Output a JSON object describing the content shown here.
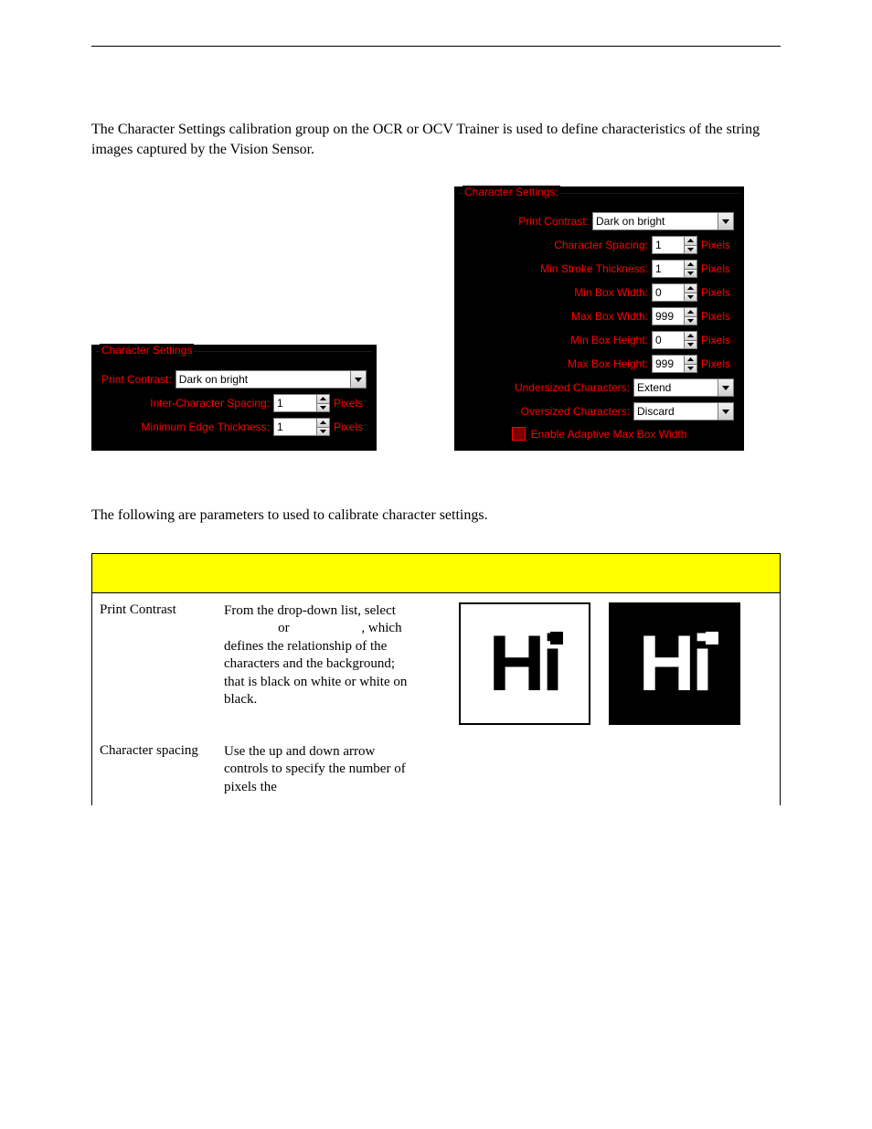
{
  "intro_text": "The Character Settings calibration group on the OCR or OCV Trainer is used to define characteristics of the string images captured by the Vision Sensor.",
  "panel_left": {
    "legend": "Character Settings",
    "rows": {
      "print_contrast": {
        "label": "Print Contrast:",
        "value": "Dark on bright"
      },
      "inter_char_spacing": {
        "label": "Inter-Character Spacing:",
        "value": "1",
        "unit": "Pixels"
      },
      "min_edge_thickness": {
        "label": "Minimum Edge Thickness:",
        "value": "1",
        "unit": "Pixels"
      }
    }
  },
  "panel_right": {
    "legend": "Character Settings:",
    "rows": {
      "print_contrast": {
        "label": "Print Contrast:",
        "value": "Dark on bright"
      },
      "char_spacing": {
        "label": "Character Spacing:",
        "value": "1",
        "unit": "Pixels"
      },
      "min_stroke": {
        "label": "Min Stroke Thickness:",
        "value": "1",
        "unit": "Pixels"
      },
      "min_box_width": {
        "label": "Min Box Width:",
        "value": "0",
        "unit": "Pixels"
      },
      "max_box_width": {
        "label": "Max Box Width:",
        "value": "999",
        "unit": "Pixels"
      },
      "min_box_height": {
        "label": "Min Box Height:",
        "value": "0",
        "unit": "Pixels"
      },
      "max_box_height": {
        "label": "Max Box Height:",
        "value": "999",
        "unit": "Pixels"
      },
      "undersized": {
        "label": "Undersized Characters:",
        "value": "Extend"
      },
      "oversized": {
        "label": "Oversized Characters:",
        "value": "Discard"
      },
      "adaptive": {
        "label": "Enable Adaptive Max Box Width"
      }
    }
  },
  "params_intro": "The following are parameters to used to calibrate character settings.",
  "table": {
    "rows": {
      "print_contrast": {
        "name": "Print Contrast",
        "desc_line1": "From the drop-down list, select",
        "desc_or": "or",
        "desc_which": ", which",
        "desc_rest": "defines the relationship of the characters and the background; that is black on white or white on black.",
        "sample_text": "Hi"
      },
      "char_spacing": {
        "name": "Character spacing",
        "desc": "Use the up and down arrow controls to specify the number of pixels the"
      }
    }
  }
}
